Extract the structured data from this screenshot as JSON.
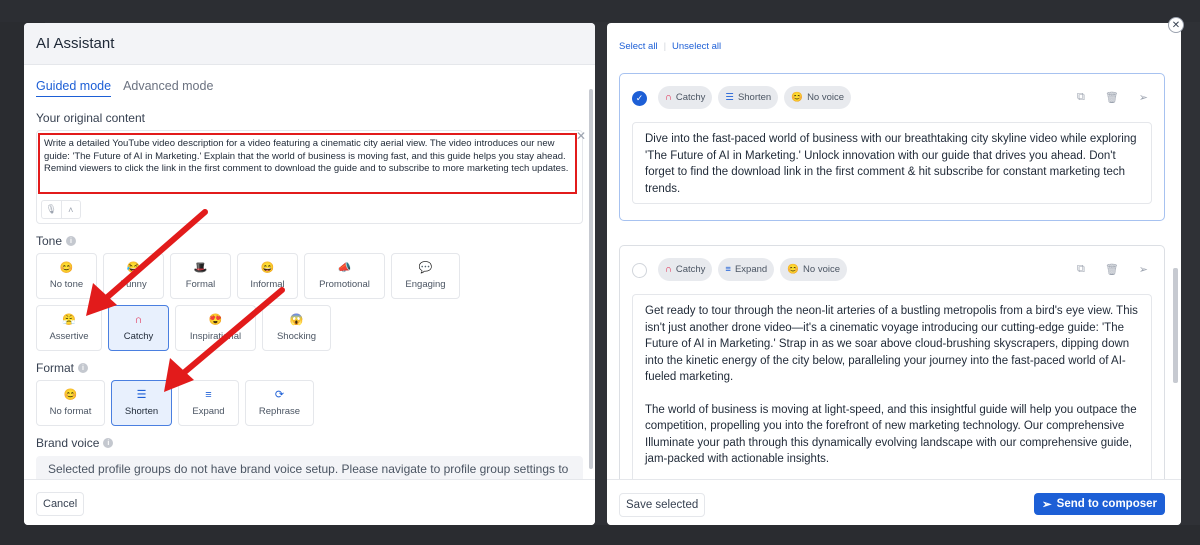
{
  "left_panel": {
    "title": "AI Assistant",
    "tabs": [
      {
        "label": "Guided mode",
        "active": true
      },
      {
        "label": "Advanced mode",
        "active": false
      }
    ],
    "original_content_label": "Your original content",
    "original_content": "Write a detailed YouTube video description for a video featuring a cinematic city aerial view. The video introduces our new guide: 'The Future of AI in Marketing.' Explain that the world of business is moving fast, and this guide helps you stay ahead. Remind viewers to click the link in the first comment to download the guide and to subscribe to more marketing tech updates.",
    "tone_label": "Tone",
    "tone_options": [
      {
        "label": "No tone",
        "icon": "😊",
        "selected": false
      },
      {
        "label": "Funny",
        "icon": "😂",
        "selected": false
      },
      {
        "label": "Formal",
        "icon": "🎩",
        "selected": false
      },
      {
        "label": "Informal",
        "icon": "😄",
        "selected": false
      },
      {
        "label": "Promotional",
        "icon": "📣",
        "selected": false
      },
      {
        "label": "Engaging",
        "icon": "💬",
        "selected": false
      },
      {
        "label": "Assertive",
        "icon": "😤",
        "selected": false
      },
      {
        "label": "Catchy",
        "icon": "∩",
        "selected": true
      },
      {
        "label": "Inspirational",
        "icon": "😍",
        "selected": false
      },
      {
        "label": "Shocking",
        "icon": "😱",
        "selected": false
      }
    ],
    "format_label": "Format",
    "format_options": [
      {
        "label": "No format",
        "icon": "😊",
        "selected": false
      },
      {
        "label": "Shorten",
        "icon": "☰",
        "selected": true
      },
      {
        "label": "Expand",
        "icon": "≡",
        "selected": false
      },
      {
        "label": "Rephrase",
        "icon": "⟳",
        "selected": false
      }
    ],
    "brand_voice_label": "Brand voice",
    "brand_voice_message": "Selected profile groups do not have brand voice setup. Please navigate to profile group settings to",
    "cancel_label": "Cancel"
  },
  "right_panel": {
    "select_all": "Select all",
    "unselect_all": "Unselect all",
    "cards": [
      {
        "checked": true,
        "chips": [
          {
            "label": "Catchy",
            "icon": "∩"
          },
          {
            "label": "Shorten",
            "icon": "☰"
          },
          {
            "label": "No voice",
            "icon": "😊"
          }
        ],
        "paragraphs": [
          "Dive into the fast-paced world of business with our breathtaking city skyline video while exploring 'The Future of AI in Marketing.' Unlock innovation with our guide that drives you ahead. Don't forget to find the download link in the first comment & hit subscribe for constant marketing tech trends."
        ]
      },
      {
        "checked": false,
        "chips": [
          {
            "label": "Catchy",
            "icon": "∩"
          },
          {
            "label": "Expand",
            "icon": "≡"
          },
          {
            "label": "No voice",
            "icon": "😊"
          }
        ],
        "paragraphs": [
          "Get ready to tour through the neon-lit arteries of a bustling metropolis from a bird's eye view. This isn't just another drone video—it's a cinematic voyage introducing our cutting-edge guide: 'The Future of AI in Marketing.' Strap in as we soar above cloud-brushing skyscrapers, dipping down into the kinetic energy of the city below, paralleling your journey into the fast-paced world of AI-fueled marketing.",
          "The world of business is moving at light-speed, and this insightful guide will help you outpace the competition, propelling you into the forefront of new marketing technology. Our comprehensive Illuminate your path through this dynamically evolving landscape with our comprehensive guide, jam-packed with actionable insights."
        ]
      }
    ],
    "save_selected": "Save selected",
    "send_to_composer": "Send to composer"
  },
  "colors": {
    "accent": "#1d5fd6",
    "highlight_red": "#e21b1b",
    "selected_bg": "#e8f0fd"
  }
}
